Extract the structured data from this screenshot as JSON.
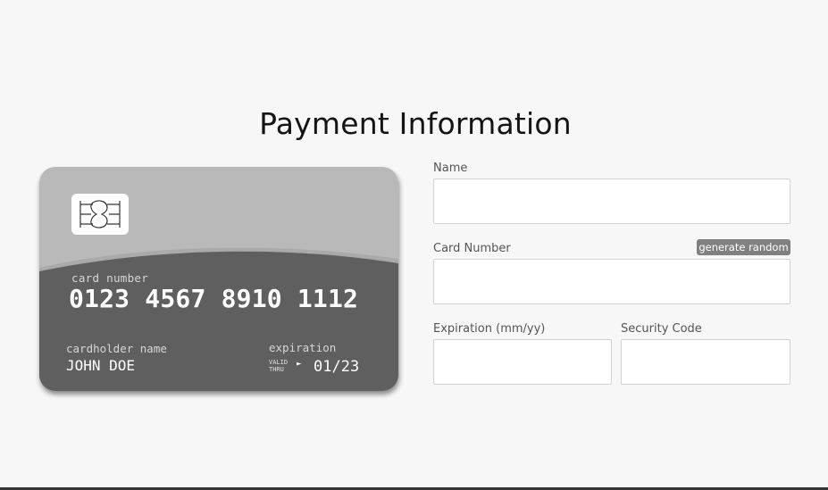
{
  "page": {
    "title": "Payment Information"
  },
  "card": {
    "number_label": "card number",
    "number": "0123 4567 8910 1112",
    "holder_label": "cardholder name",
    "holder": "JOHN DOE",
    "expiration_label": "expiration",
    "valid_line1": "VALID",
    "valid_line2": "THRU",
    "arrow": "►",
    "expiration": "01/23",
    "colors": {
      "top": "#b9b9b9",
      "wave_light": "#aaaaaa",
      "body": "#5f5f5f",
      "chip": "#ffffff"
    }
  },
  "form": {
    "name_label": "Name",
    "name_value": "",
    "card_number_label": "Card Number",
    "card_number_value": "",
    "generate_button": "generate random",
    "expiration_label": "Expiration (mm/yy)",
    "expiration_value": "",
    "security_label": "Security Code",
    "security_value": ""
  }
}
